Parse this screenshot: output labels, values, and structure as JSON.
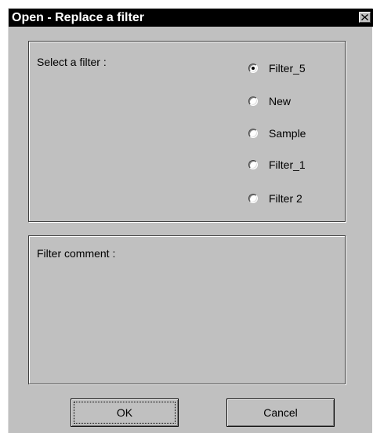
{
  "window": {
    "title": "Open - Replace a filter",
    "close_icon": "close-icon"
  },
  "filter_group": {
    "label": "Select a filter :",
    "options": [
      {
        "label": "Filter_5",
        "selected": true
      },
      {
        "label": "New",
        "selected": false
      },
      {
        "label": "Sample",
        "selected": false
      },
      {
        "label": "Filter_1",
        "selected": false
      },
      {
        "label": "Filter 2",
        "selected": false
      }
    ]
  },
  "comment_group": {
    "label": "Filter comment :",
    "value": ""
  },
  "buttons": {
    "ok_label": "OK",
    "cancel_label": "Cancel"
  },
  "colors": {
    "dialog_bg": "#c0c0c0",
    "titlebar_bg": "#000000",
    "title_text": "#ffffff"
  }
}
